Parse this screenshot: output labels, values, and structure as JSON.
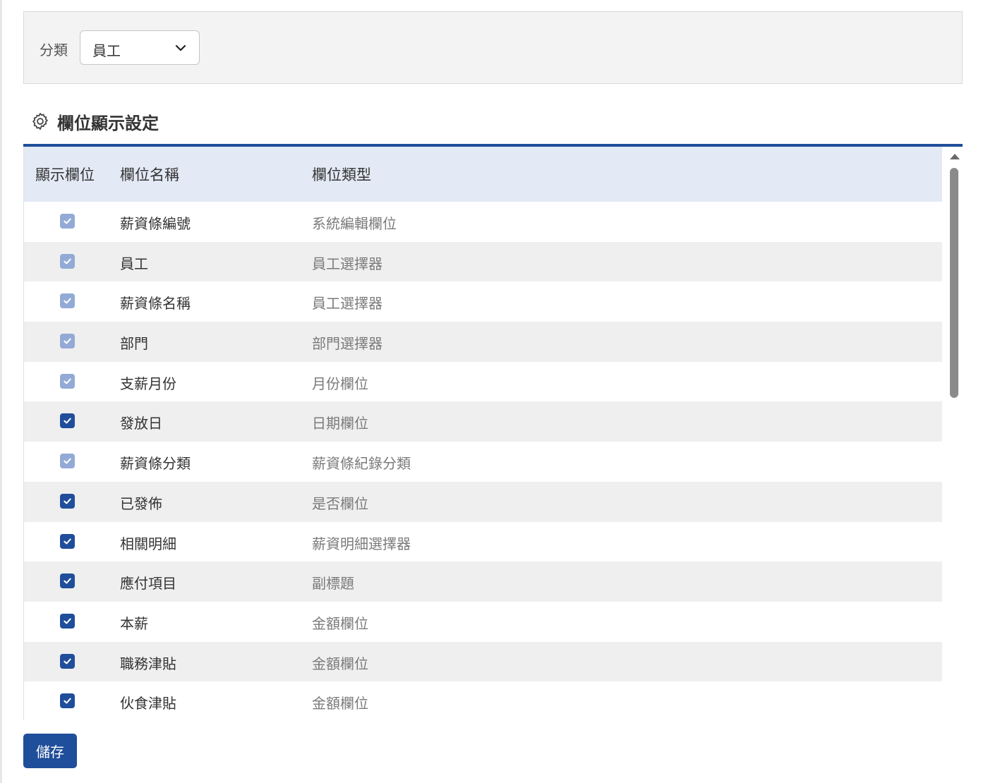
{
  "filter": {
    "label": "分類",
    "selected": "員工"
  },
  "section": {
    "title": "欄位顯示設定",
    "icon": "gear-icon"
  },
  "table": {
    "headers": [
      "顯示欄位",
      "欄位名稱",
      "欄位類型"
    ],
    "rows": [
      {
        "checked": true,
        "disabled": true,
        "name": "薪資條編號",
        "type": "系統編輯欄位"
      },
      {
        "checked": true,
        "disabled": true,
        "name": "員工",
        "type": "員工選擇器"
      },
      {
        "checked": true,
        "disabled": true,
        "name": "薪資條名稱",
        "type": "員工選擇器"
      },
      {
        "checked": true,
        "disabled": true,
        "name": "部門",
        "type": "部門選擇器"
      },
      {
        "checked": true,
        "disabled": true,
        "name": "支薪月份",
        "type": "月份欄位"
      },
      {
        "checked": true,
        "disabled": false,
        "name": "發放日",
        "type": "日期欄位"
      },
      {
        "checked": true,
        "disabled": true,
        "name": "薪資條分類",
        "type": "薪資條紀錄分類"
      },
      {
        "checked": true,
        "disabled": false,
        "name": "已發佈",
        "type": "是否欄位"
      },
      {
        "checked": true,
        "disabled": false,
        "name": "相關明細",
        "type": "薪資明細選擇器"
      },
      {
        "checked": true,
        "disabled": false,
        "name": "應付項目",
        "type": "副標題"
      },
      {
        "checked": true,
        "disabled": false,
        "name": "本薪",
        "type": "金額欄位"
      },
      {
        "checked": true,
        "disabled": false,
        "name": "職務津貼",
        "type": "金額欄位"
      },
      {
        "checked": true,
        "disabled": false,
        "name": "伙食津貼",
        "type": "金額欄位"
      }
    ]
  },
  "actions": {
    "save_label": "儲存"
  },
  "colors": {
    "accent": "#1f4e9a",
    "checkbox_disabled": "#93aad6",
    "header_bg": "#e3e9f5",
    "row_alt_bg": "#efefef"
  }
}
